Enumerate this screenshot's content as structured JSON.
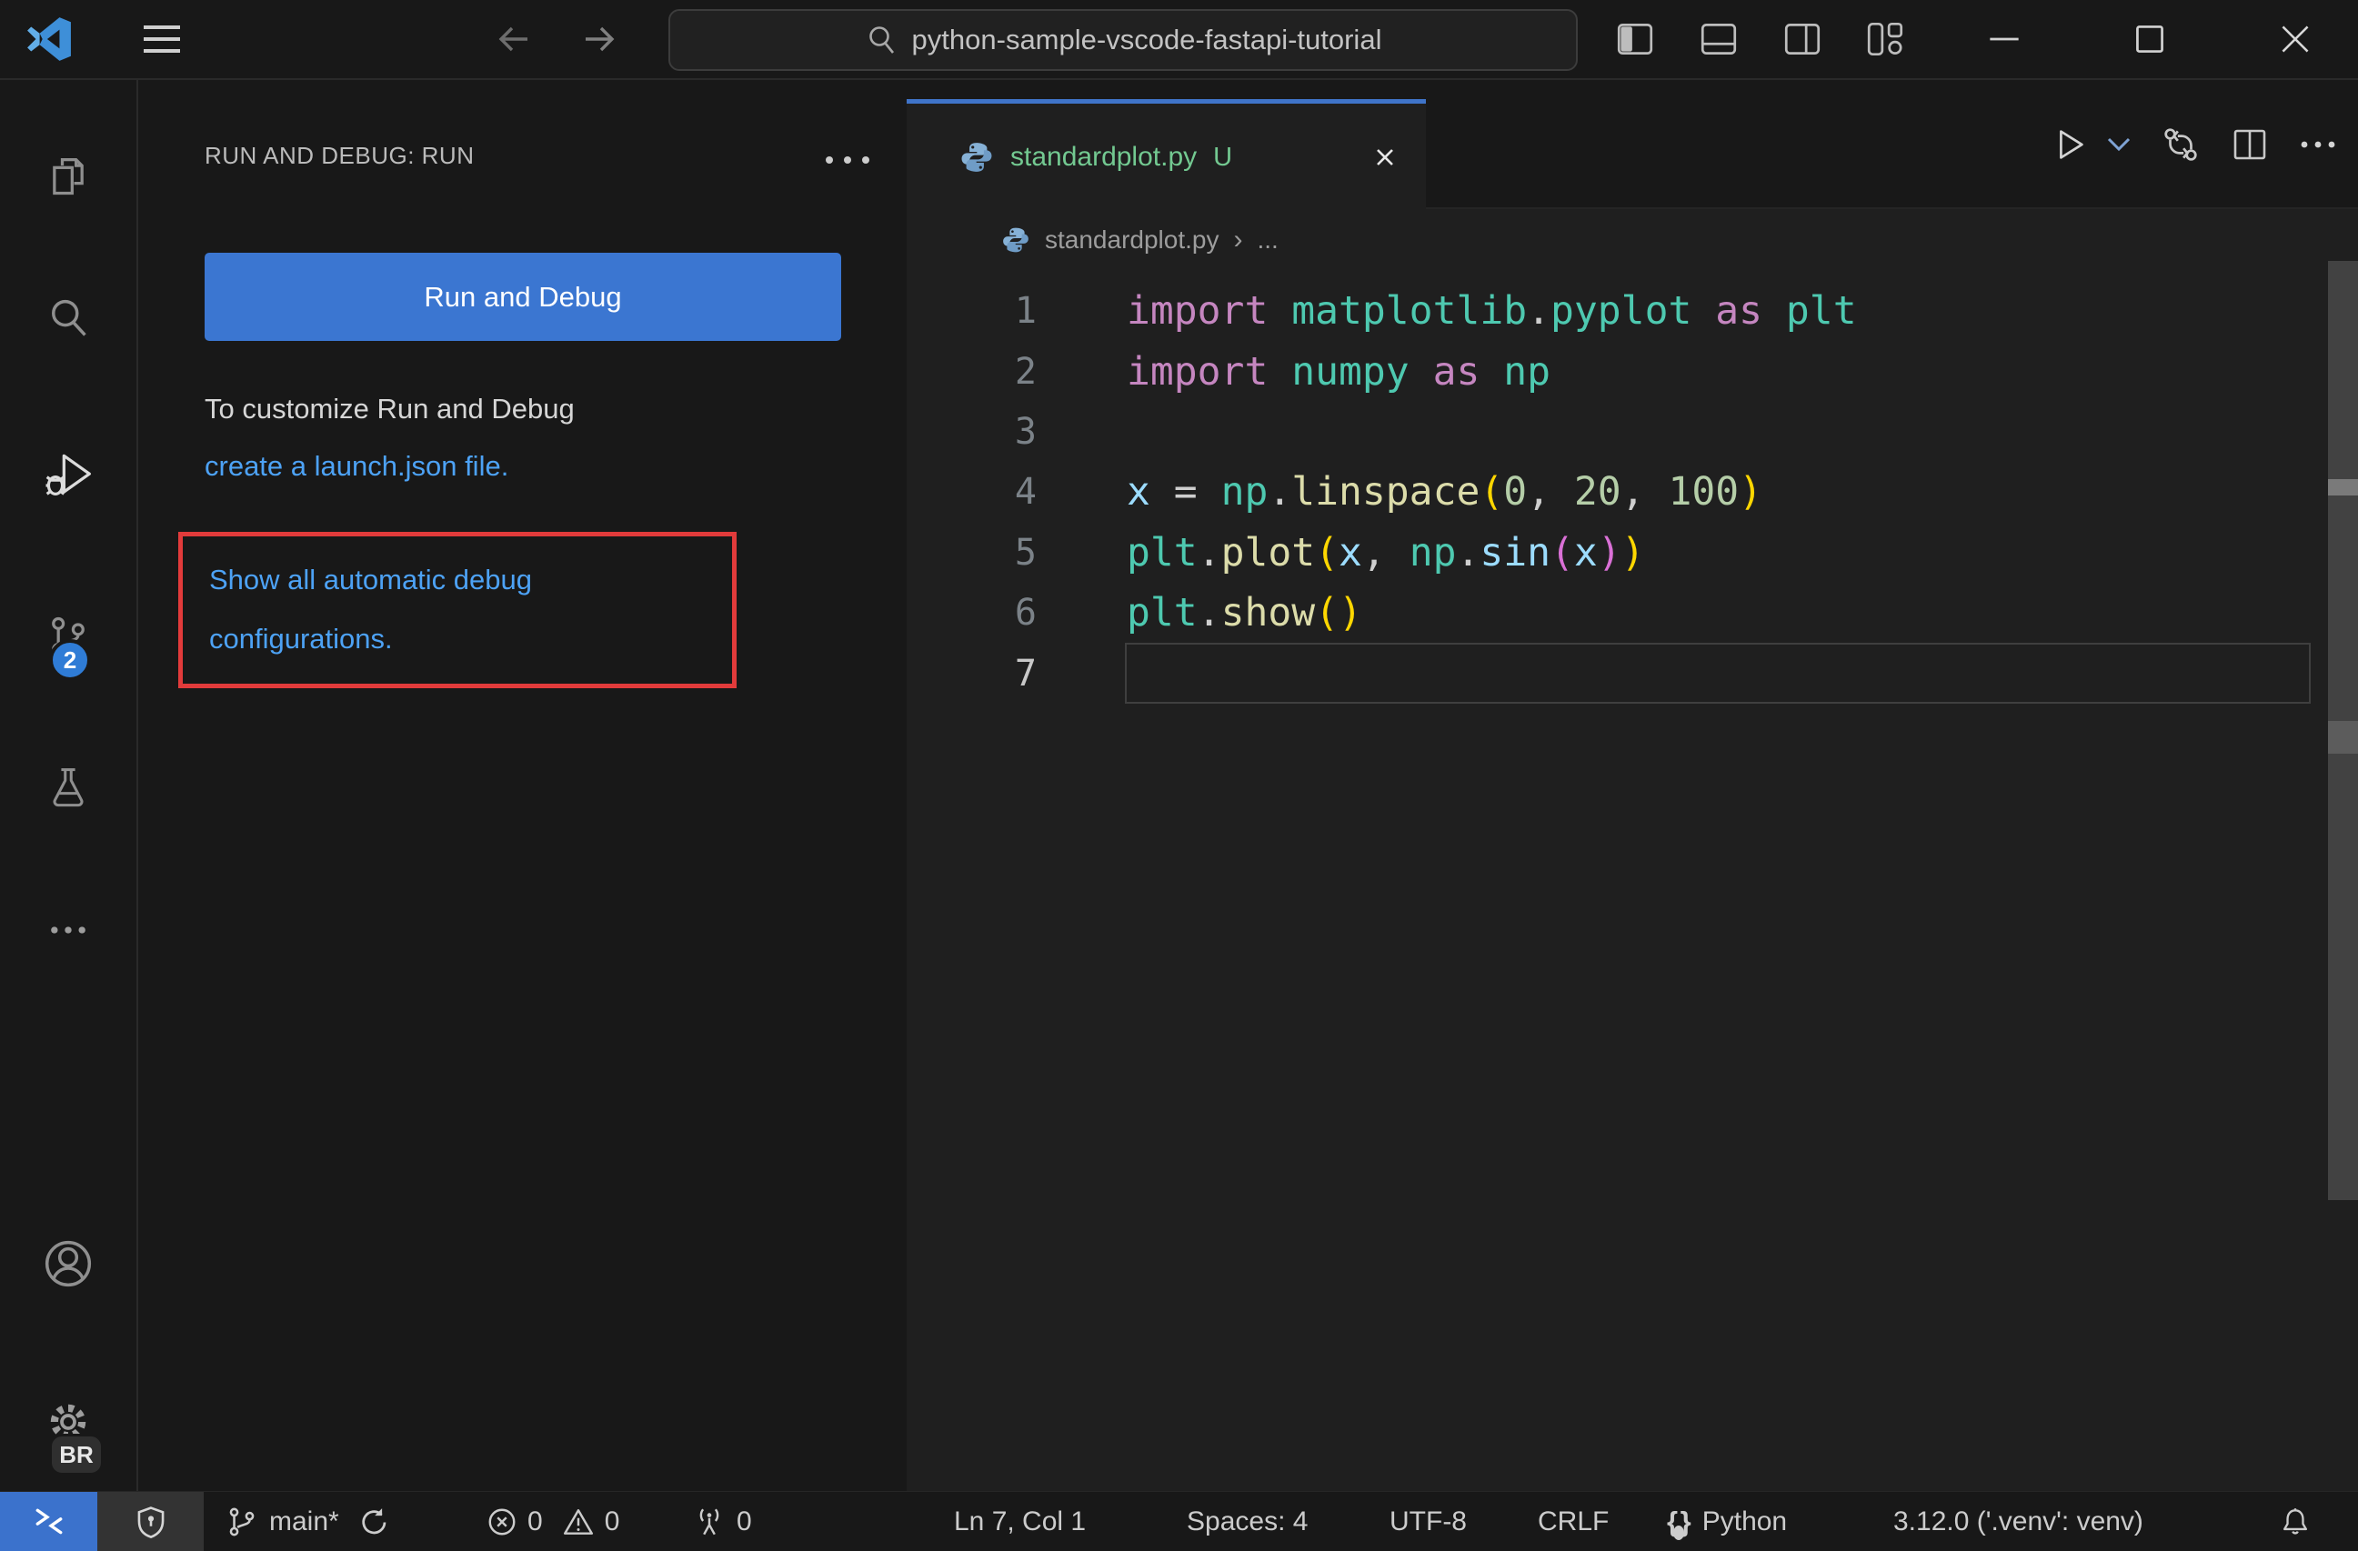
{
  "window": {
    "search_value": "python-sample-vscode-fastapi-tutorial"
  },
  "colors": {
    "accent_button_blue": "#3b76d1",
    "link_blue": "#4da2f5",
    "tab_accent_blue": "#3f74c9",
    "untracked_green": "#73c991",
    "scm_badge_blue": "#2f7cd6",
    "remote_blue": "#3b72cc",
    "highlight_red": "#e23b3b",
    "editor_bg": "#1f1f1f",
    "chrome_bg": "#181818"
  },
  "activity_bar": {
    "icons": [
      "explorer",
      "search",
      "run-and-debug",
      "source-control",
      "testing",
      "more-views",
      "account",
      "settings-gear"
    ],
    "active_icon": "run-and-debug",
    "scm_badge": "2",
    "gear_badge": "BR"
  },
  "sidebar": {
    "title": "RUN AND DEBUG: RUN",
    "run_button": "Run and Debug",
    "customize_line": "To customize Run and Debug",
    "launch_link": "create a launch.json file.",
    "show_configs_link": "Show all automatic debug configurations."
  },
  "editor": {
    "tab": {
      "file": "standardplot.py",
      "modified_badge": "U"
    },
    "breadcrumb": {
      "file": "standardplot.py",
      "symbol": "..."
    },
    "toolbar_icons": [
      "run-python-file",
      "run-dropdown",
      "open-changes",
      "split-editor",
      "more-actions"
    ],
    "code": {
      "cursor_line": 7,
      "token_colors": {
        "kw": "#C586C0",
        "mod": "#4EC9B0",
        "fn": "#DCDCAA",
        "var": "#9CDCFE",
        "num": "#B5CEA8",
        "p": "#CFCFCF",
        "b1": "#FFD700",
        "b2": "#DA70D6"
      },
      "lines": [
        [
          [
            "kw",
            "import"
          ],
          [
            "p",
            " "
          ],
          [
            "mod",
            "matplotlib"
          ],
          [
            "p",
            "."
          ],
          [
            "mod",
            "pyplot"
          ],
          [
            "p",
            " "
          ],
          [
            "kw",
            "as"
          ],
          [
            "p",
            " "
          ],
          [
            "mod",
            "plt"
          ]
        ],
        [
          [
            "kw",
            "import"
          ],
          [
            "p",
            " "
          ],
          [
            "mod",
            "numpy"
          ],
          [
            "p",
            " "
          ],
          [
            "kw",
            "as"
          ],
          [
            "p",
            " "
          ],
          [
            "mod",
            "np"
          ]
        ],
        [],
        [
          [
            "var",
            "x"
          ],
          [
            "p",
            " = "
          ],
          [
            "mod",
            "np"
          ],
          [
            "p",
            "."
          ],
          [
            "fn",
            "linspace"
          ],
          [
            "b1",
            "("
          ],
          [
            "num",
            "0"
          ],
          [
            "p",
            ", "
          ],
          [
            "num",
            "20"
          ],
          [
            "p",
            ", "
          ],
          [
            "num",
            "100"
          ],
          [
            "b1",
            ")"
          ]
        ],
        [
          [
            "mod",
            "plt"
          ],
          [
            "p",
            "."
          ],
          [
            "fn",
            "plot"
          ],
          [
            "b1",
            "("
          ],
          [
            "var",
            "x"
          ],
          [
            "p",
            ", "
          ],
          [
            "mod",
            "np"
          ],
          [
            "p",
            "."
          ],
          [
            "var",
            "sin"
          ],
          [
            "b2",
            "("
          ],
          [
            "var",
            "x"
          ],
          [
            "b2",
            ")"
          ],
          [
            "b1",
            ")"
          ]
        ],
        [
          [
            "mod",
            "plt"
          ],
          [
            "p",
            "."
          ],
          [
            "fn",
            "show"
          ],
          [
            "b1",
            "("
          ],
          [
            "b1",
            ")"
          ]
        ],
        []
      ]
    }
  },
  "status_bar": {
    "branch": "main*",
    "errors": "0",
    "warnings": "0",
    "ports": "0",
    "line_col": "Ln 7, Col 1",
    "indentation": "Spaces: 4",
    "encoding": "UTF-8",
    "eol": "CRLF",
    "language": "Python",
    "interpreter": "3.12.0 ('.venv': venv)"
  }
}
